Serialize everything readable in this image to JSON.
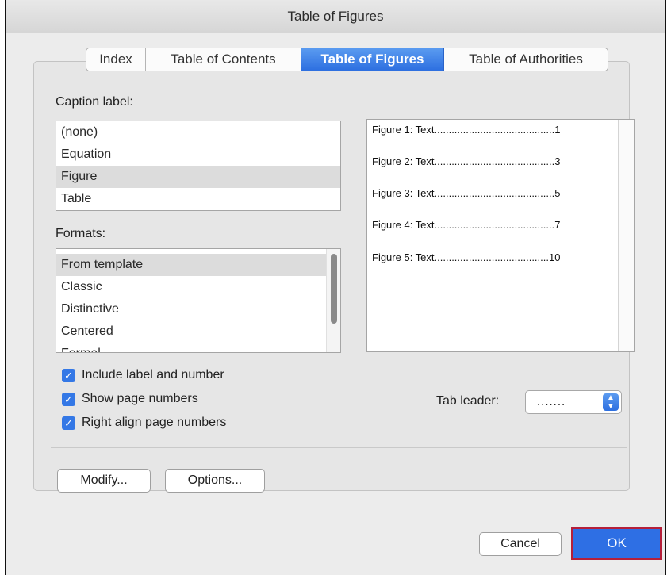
{
  "window": {
    "title": "Table of Figures"
  },
  "tabs": [
    {
      "label": "Index",
      "active": false
    },
    {
      "label": "Table of Contents",
      "active": false
    },
    {
      "label": "Table of Figures",
      "active": true
    },
    {
      "label": "Table of Authorities",
      "active": false
    }
  ],
  "caption": {
    "label": "Caption label:",
    "items": [
      "(none)",
      "Equation",
      "Figure",
      "Table"
    ],
    "selected": "Figure"
  },
  "formats": {
    "label": "Formats:",
    "items": [
      "From template",
      "Classic",
      "Distinctive",
      "Centered",
      "Formal"
    ],
    "selected": "From template"
  },
  "preview": {
    "rows": [
      "Figure 1: Text..........................................1",
      "Figure 2: Text..........................................3",
      "Figure 3: Text..........................................5",
      "Figure 4: Text..........................................7",
      "Figure 5: Text........................................10"
    ]
  },
  "options": {
    "include_label": "Include label and number",
    "show_page_numbers": "Show page numbers",
    "right_align": "Right align page numbers",
    "checkmark": "✓"
  },
  "tab_leader": {
    "label": "Tab leader:",
    "value": "......."
  },
  "buttons": {
    "modify": "Modify...",
    "options": "Options...",
    "cancel": "Cancel",
    "ok": "OK"
  },
  "colors": {
    "accent": "#2e6fe4",
    "highlight_frame": "#b51f3a"
  }
}
